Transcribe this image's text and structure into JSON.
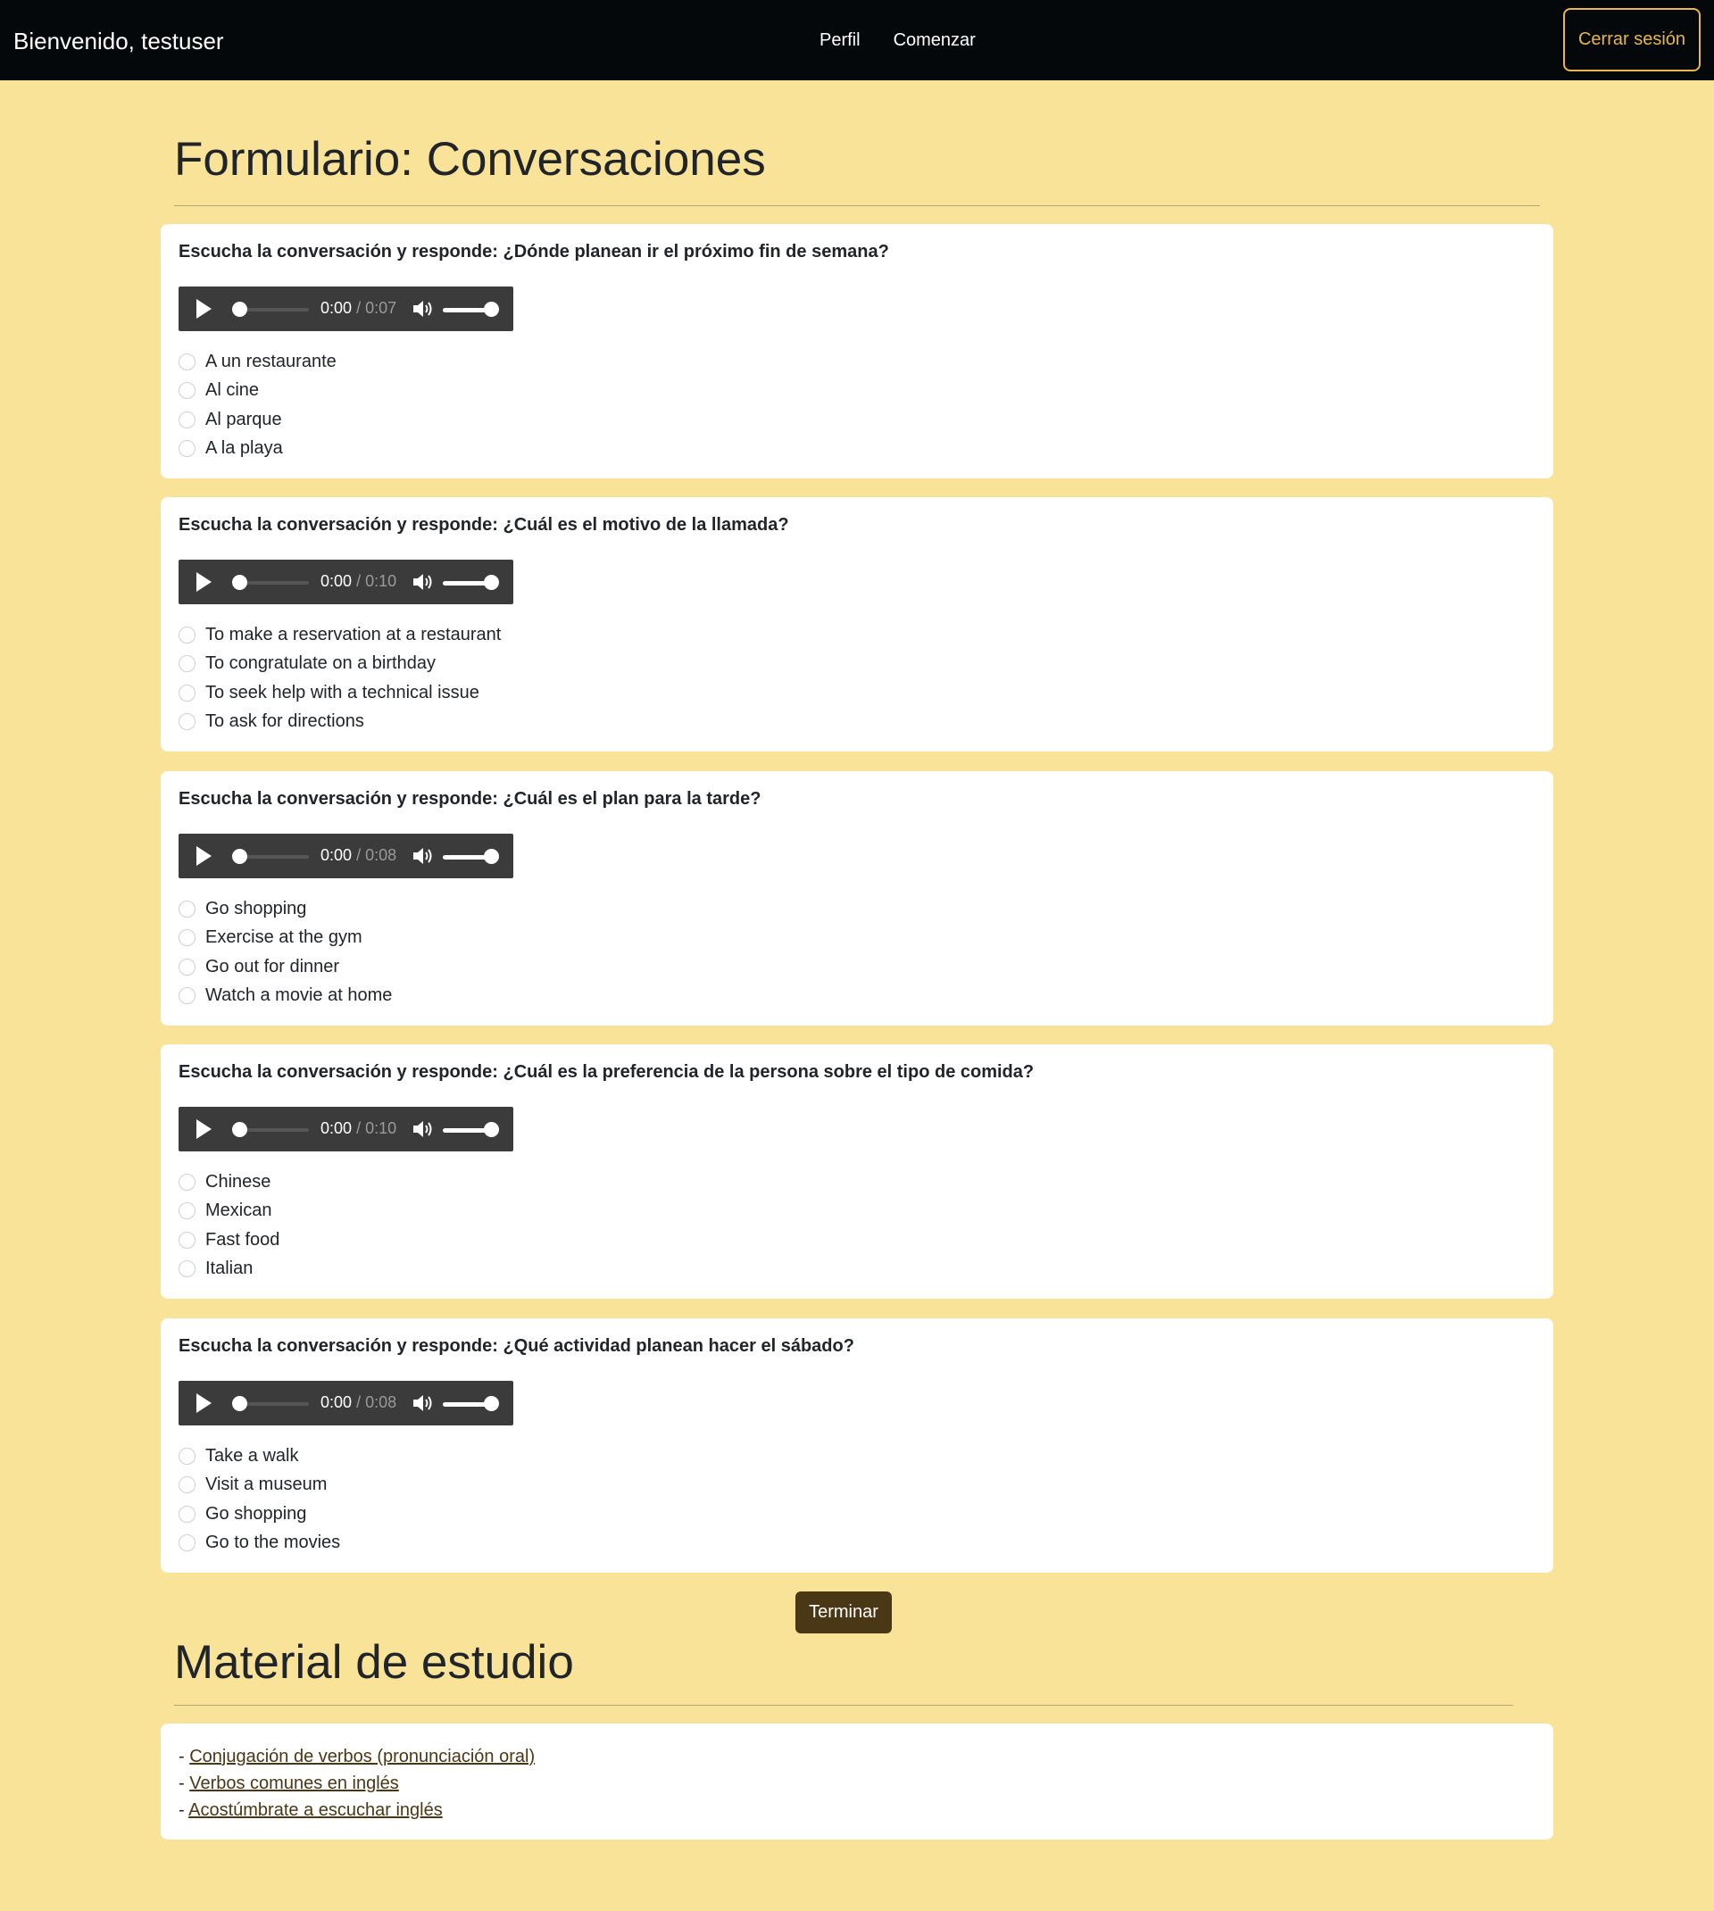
{
  "navbar": {
    "brand": "Bienvenido, testuser",
    "links": [
      "Perfil",
      "Comenzar"
    ],
    "logout_label": "Cerrar sesión"
  },
  "form": {
    "title": "Formulario: Conversaciones",
    "questions": [
      {
        "text": "Escucha la conversación y responde: ¿Dónde planean ir el próximo fin de semana?",
        "current_time": "0:00",
        "duration": "/ 0:07",
        "options": [
          "A un restaurante",
          "Al cine",
          "Al parque",
          "A la playa"
        ]
      },
      {
        "text": "Escucha la conversación y responde: ¿Cuál es el motivo de la llamada?",
        "current_time": "0:00",
        "duration": "/ 0:10",
        "options": [
          "To make a reservation at a restaurant",
          "To congratulate on a birthday",
          "To seek help with a technical issue",
          "To ask for directions"
        ]
      },
      {
        "text": "Escucha la conversación y responde: ¿Cuál es el plan para la tarde?",
        "current_time": "0:00",
        "duration": "/ 0:08",
        "options": [
          "Go shopping",
          "Exercise at the gym",
          "Go out for dinner",
          "Watch a movie at home"
        ]
      },
      {
        "text": "Escucha la conversación y responde: ¿Cuál es la preferencia de la persona sobre el tipo de comida?",
        "current_time": "0:00",
        "duration": "/ 0:10",
        "options": [
          "Chinese",
          "Mexican",
          "Fast food",
          "Italian"
        ]
      },
      {
        "text": "Escucha la conversación y responde: ¿Qué actividad planean hacer el sábado?",
        "current_time": "0:00",
        "duration": "/ 0:08",
        "options": [
          "Take a walk",
          "Visit a museum",
          "Go shopping",
          "Go to the movies"
        ]
      }
    ],
    "finish_label": "Terminar"
  },
  "study": {
    "title": "Material de estudio",
    "prefix": "- ",
    "links": [
      "Conjugación de verbos (pronunciación oral)",
      "Verbos comunes en inglés",
      "Acostúmbrate a escuchar inglés"
    ]
  },
  "colors": {
    "page_bg": "#f9e398",
    "navbar_bg": "#05080b",
    "accent": "#e8b64a",
    "button_bg": "#4a3716",
    "link": "#4a3716"
  }
}
